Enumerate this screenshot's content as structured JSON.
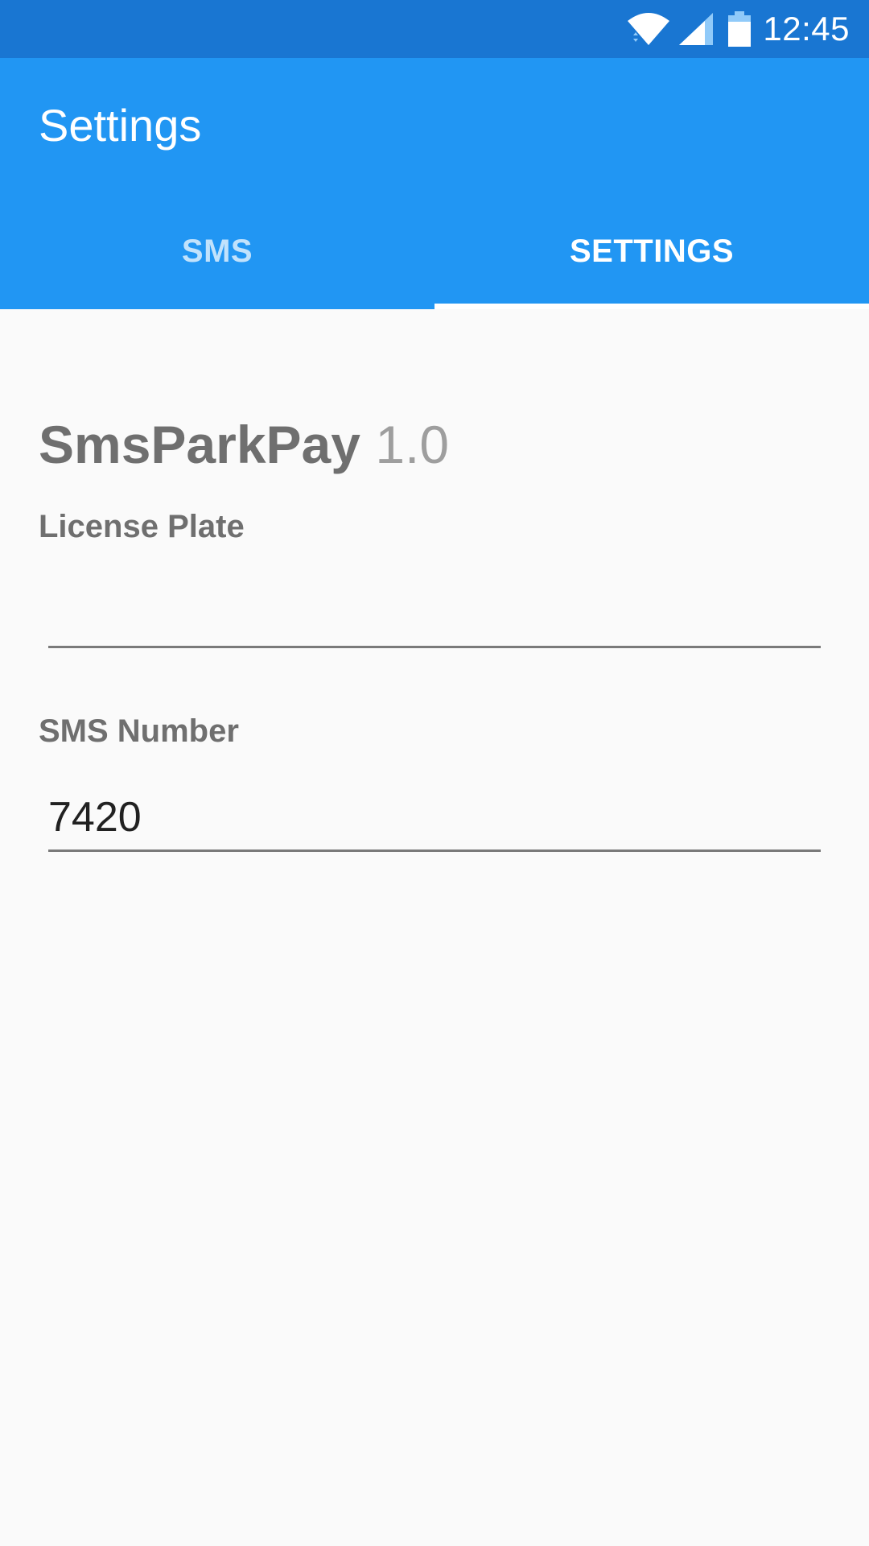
{
  "status_bar": {
    "time": "12:45",
    "icons": [
      "wifi-icon",
      "signal-icon",
      "battery-icon"
    ],
    "color": "#1976d2"
  },
  "toolbar": {
    "title": "Settings",
    "color": "#2196f3"
  },
  "tabs": [
    {
      "label": "SMS",
      "selected": false
    },
    {
      "label": "SETTINGS",
      "selected": true
    }
  ],
  "settings": {
    "app_name": "SmsParkPay",
    "app_version": "1.0",
    "license_plate": {
      "label": "License Plate",
      "value": ""
    },
    "sms_number": {
      "label": "SMS Number",
      "value": "7420"
    }
  }
}
